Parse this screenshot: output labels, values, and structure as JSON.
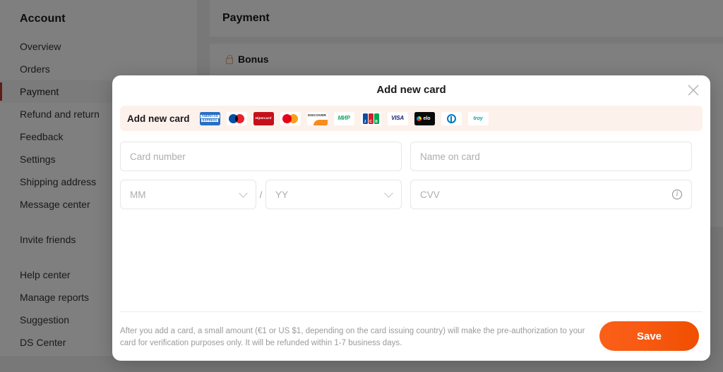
{
  "sidebar": {
    "title": "Account",
    "items": [
      {
        "label": "Overview",
        "active": false
      },
      {
        "label": "Orders",
        "active": false
      },
      {
        "label": "Payment",
        "active": true
      },
      {
        "label": "Refund and return",
        "active": false
      },
      {
        "label": "Feedback",
        "active": false
      },
      {
        "label": "Settings",
        "active": false
      },
      {
        "label": "Shipping address",
        "active": false
      },
      {
        "label": "Message center",
        "active": false
      }
    ],
    "items_group2": [
      {
        "label": "Invite friends",
        "active": false
      }
    ],
    "items_group3": [
      {
        "label": "Help center",
        "active": false
      },
      {
        "label": "Manage reports",
        "active": false
      },
      {
        "label": "Suggestion",
        "active": false
      },
      {
        "label": "DS Center",
        "active": false
      }
    ]
  },
  "main": {
    "page_title": "Payment",
    "bonus_section": "Bonus",
    "bonus_icon": "lock-icon"
  },
  "modal": {
    "title": "Add new card",
    "close_icon": "close-icon",
    "brands_label": "Add new card",
    "brands": [
      {
        "name": "american-express",
        "text": "AMERICAN EXPRESS"
      },
      {
        "name": "maestro",
        "text": "maestro"
      },
      {
        "name": "hipercard",
        "text": "Hipercard"
      },
      {
        "name": "mastercard",
        "text": "mastercard"
      },
      {
        "name": "discover",
        "text": "DISCOVER"
      },
      {
        "name": "mir",
        "text": "МИР"
      },
      {
        "name": "jcb",
        "text": "JCB"
      },
      {
        "name": "visa",
        "text": "VISA"
      },
      {
        "name": "elo",
        "text": "elo"
      },
      {
        "name": "diners-club",
        "text": "Diners Club"
      },
      {
        "name": "troy",
        "text": "troy"
      }
    ],
    "fields": {
      "card_number": {
        "placeholder": "Card number",
        "value": ""
      },
      "name_on_card": {
        "placeholder": "Name on card",
        "value": ""
      },
      "expiry_month": {
        "placeholder": "MM",
        "value": ""
      },
      "expiry_separator": "/",
      "expiry_year": {
        "placeholder": "YY",
        "value": ""
      },
      "cvv": {
        "placeholder": "CVV",
        "value": "",
        "info_icon": "info-circle-icon"
      }
    },
    "footer_note": "After you add a card, a small amount (€1 or US $1, depending on the card issuing country) will make the pre-authorization to your card for verification purposes only. It will be refunded within 1-7 business days.",
    "save_label": "Save"
  },
  "colors": {
    "accent_orange": "#f85a12",
    "active_bar_red": "#c0392b",
    "banner_pink": "#fdf1ec",
    "overlay": "rgba(0,0,0,0.50)"
  }
}
